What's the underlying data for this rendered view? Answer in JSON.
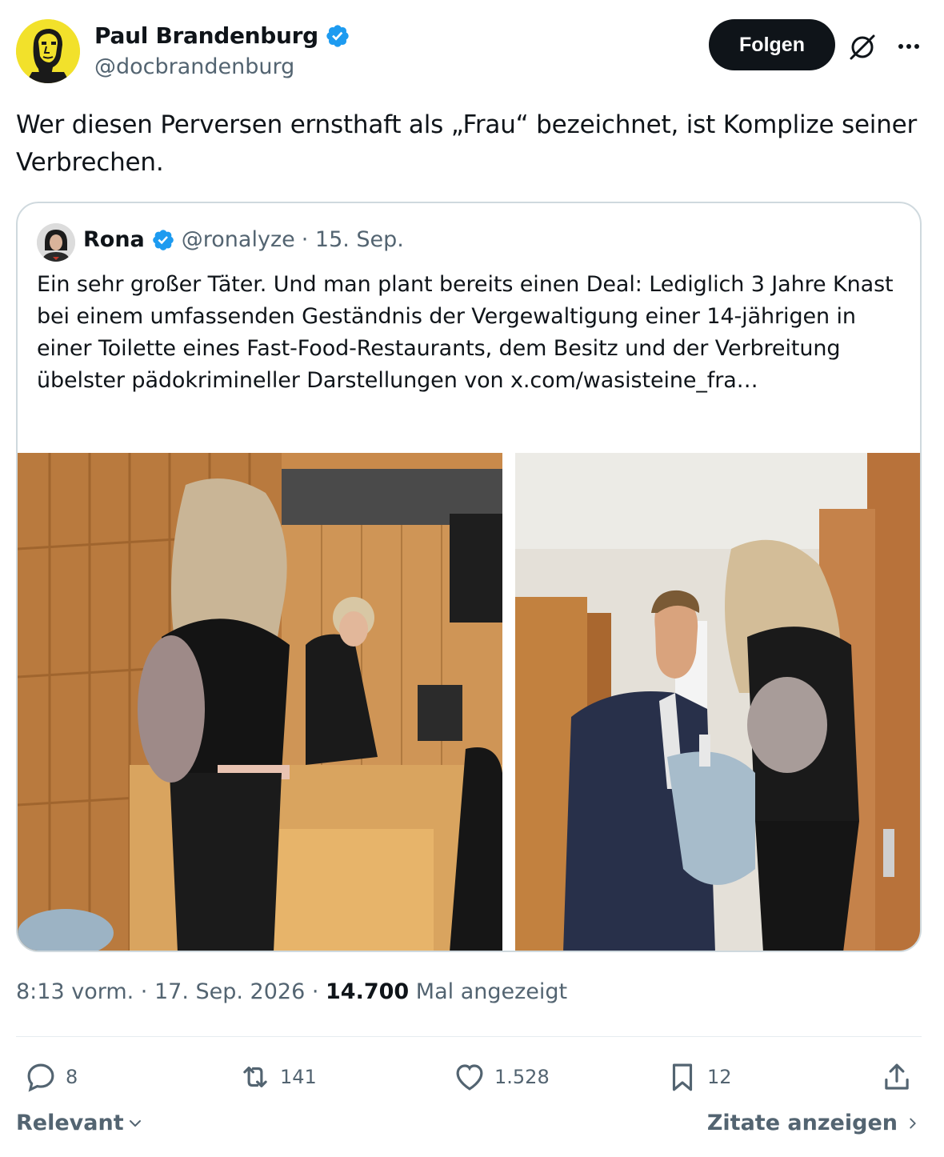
{
  "author": {
    "name": "Paul Brandenburg",
    "handle": "@docbrandenburg",
    "avatar_icon": "avatar-caricature",
    "verified": true
  },
  "header": {
    "follow_label": "Folgen",
    "grok_icon": "grok-icon",
    "more_icon": "more-icon"
  },
  "tweet": {
    "text": "Wer diesen Perversen ernsthaft als „Frau“ bezeichnet, ist Komplize seiner Verbrechen."
  },
  "quote": {
    "name": "Rona",
    "handle": "@ronalyze",
    "date": "· 15. Sep.",
    "verified": true,
    "text": "Ein sehr großer Täter. Und man plant bereits einen Deal: Lediglich 3 Jahre Knast bei einem umfassenden Geständnis der Vergewaltigung einer 14-jährigen in einer Toilette eines Fast-Food-Restaurants, dem Besitz und der Verbreitung übelster pädokrimineller Darstellungen von ",
    "link": "x.com/wasisteine_fra…"
  },
  "meta": {
    "time": "8:13 vorm. · 17. Sep. 2026 · ",
    "views": "14.700",
    "views_label": " Mal angezeigt"
  },
  "actions": {
    "replies": "8",
    "reposts": "141",
    "likes": "1.528",
    "bookmarks": "12"
  },
  "footer": {
    "sort_label": "Relevant",
    "quotes_label": "Zitate anzeigen"
  },
  "colors": {
    "verified": "#1d9bf0",
    "secondary": "#536471",
    "primary": "#0f1419",
    "avatar_bg": "#f2e12b"
  }
}
